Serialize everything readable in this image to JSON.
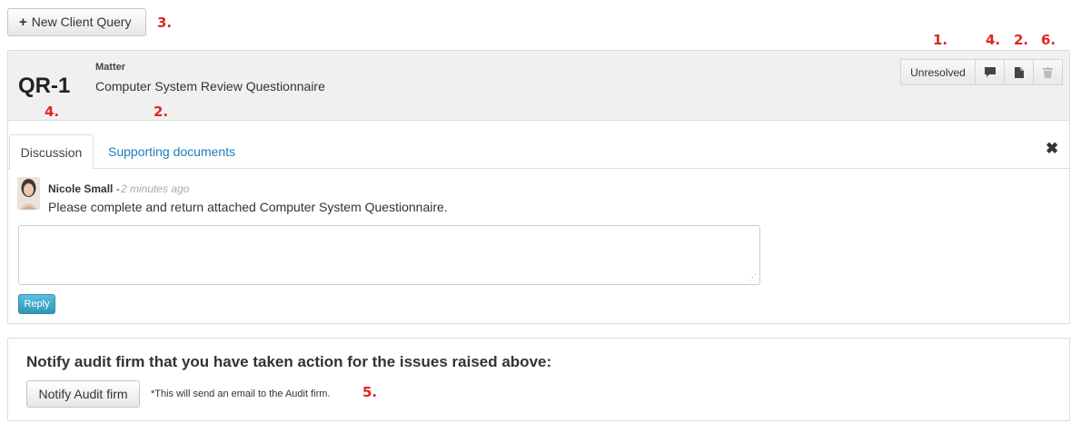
{
  "toolbar": {
    "new_query_label": "New Client Query",
    "plus_icon": "+"
  },
  "annotations": [
    "3.",
    "1.",
    "4.",
    "2.",
    "6.",
    "4.",
    "2.",
    "5."
  ],
  "query": {
    "id": "QR-1",
    "matter_label": "Matter",
    "matter_value": "Computer System Review Questionnaire",
    "status_label": "Unresolved",
    "icons": [
      "comment-icon",
      "file-icon",
      "trash-icon"
    ]
  },
  "tabs": {
    "discussion": "Discussion",
    "supporting_documents": "Supporting documents",
    "close_glyph": "✖"
  },
  "comment": {
    "author": "Nicole Small",
    "separator": " - ",
    "time": "2 minutes ago",
    "text": "Please complete and return attached Computer System Questionnaire."
  },
  "reply": {
    "value": "",
    "button_label": "Reply"
  },
  "notify": {
    "title": "Notify audit firm that you have taken action for the issues raised above:",
    "button_label": "Notify Audit firm",
    "note": "*This will send an email to the Audit firm."
  },
  "colors": {
    "annotation": "#e0261f",
    "link": "#1a7ec0",
    "reply_button": "#2f96b4"
  }
}
